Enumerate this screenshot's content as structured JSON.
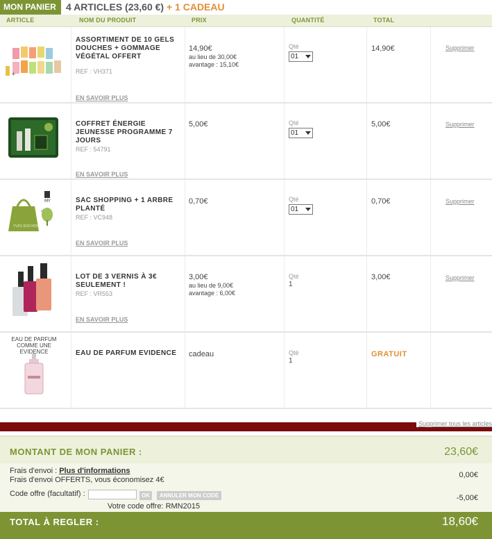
{
  "header": {
    "title": "MON PANIER",
    "summary": "4 ARTICLES (23,60 €)",
    "gift": "+ 1 CADEAU"
  },
  "columns": {
    "article": "ARTICLE",
    "product": "NOM DU PRODUIT",
    "price": "PRIX",
    "quantity": "QUANTITÉ",
    "total": "TOTAL"
  },
  "items": [
    {
      "name": "ASSORTIMENT DE 10 GELS DOUCHES + GOMMAGE VÉGÉTAL OFFERT",
      "ref": "REF : VH371",
      "more": "EN SAVOIR PLUS",
      "price": "14,90€",
      "was": "au lieu de 30,00€",
      "saving": "avantage : 15,10€",
      "qty_label": "Qté",
      "qty": "01",
      "total": "14,90€",
      "delete": "Supprimer"
    },
    {
      "name": "COFFRET ÉNERGIE JEUNESSE PROGRAMME 7 JOURS",
      "ref": "REF : 54791",
      "more": "EN SAVOIR PLUS",
      "price": "5,00€",
      "qty_label": "Qté",
      "qty": "01",
      "total": "5,00€",
      "delete": "Supprimer"
    },
    {
      "name": "SAC SHOPPING + 1 ARBRE PLANTÉ",
      "ref": "REF : VC948",
      "more": "EN SAVOIR PLUS",
      "price": "0,70€",
      "qty_label": "Qté",
      "qty": "01",
      "total": "0,70€",
      "delete": "Supprimer"
    },
    {
      "name": "LOT DE 3 VERNIS À 3€ SEULEMENT !",
      "ref": "REF : VR553",
      "more": "EN SAVOIR PLUS",
      "price": "3,00€",
      "was": "au lieu de 9,00€",
      "saving": "avantage : 6,00€",
      "qty_label": "Qté",
      "qty": "1",
      "total": "3,00€",
      "delete": "Supprimer"
    },
    {
      "caption": "EAU DE PARFUM COMME UNE EVIDENCE",
      "name": "EAU DE PARFUM EVIDENCE",
      "price": "cadeau",
      "qty_label": "Qté",
      "qty": "1",
      "total": "GRATUIT"
    }
  ],
  "delete_all": "Supprimer tous les articles",
  "cart_total": {
    "label": "MONTANT DE MON PANIER :",
    "value": "23,60€"
  },
  "fees": {
    "shipping_label": "Frais d'envoi :",
    "shipping_link": "Plus d'informations",
    "shipping_value": "0,00€",
    "free_shipping": "Frais d'envoi OFFERTS, vous économisez 4€",
    "code_label": "Code offre (facultatif) :",
    "ok_button": "OK",
    "cancel_button": "ANNULER MON CODE",
    "code_value": "-5,00€",
    "your_code": "Votre code offre: RMN2015"
  },
  "grand_total": {
    "label": "TOTAL À REGLER :",
    "value": "18,60€"
  },
  "colors": {
    "brand_green": "#7d9435",
    "accent_orange": "#e08f35",
    "dark_red": "#7a0c0c"
  }
}
